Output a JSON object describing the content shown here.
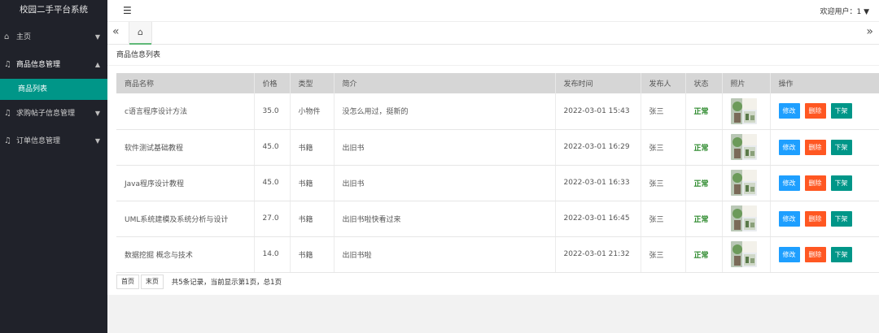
{
  "app": {
    "title": "校园二手平台系统"
  },
  "header": {
    "welcome": "欢迎用户：1",
    "welcome_caret": "▼"
  },
  "sidebar": {
    "items": [
      {
        "label": "主页",
        "icon": "home-icon"
      },
      {
        "label": "商品信息管理",
        "icon": "bell-icon",
        "open": true,
        "children": [
          {
            "label": "商品列表"
          }
        ]
      },
      {
        "label": "求购帖子信息管理",
        "icon": "bell-icon"
      },
      {
        "label": "订单信息管理",
        "icon": "bell-icon"
      }
    ]
  },
  "tabs": {
    "left_arrow": "«",
    "home": "⌂",
    "right_arrow": "»"
  },
  "card": {
    "title": "商品信息列表"
  },
  "table": {
    "headers": [
      "商品名称",
      "价格",
      "类型",
      "简介",
      "发布时间",
      "发布人",
      "状态",
      "照片",
      "操作"
    ],
    "rows": [
      {
        "name": "c语言程序设计方法",
        "price": "35.0",
        "type": "小物件",
        "desc": "没怎么用过，挺新的",
        "time": "2022-03-01 15:43",
        "user": "张三",
        "status": "正常"
      },
      {
        "name": "软件测试基础教程",
        "price": "45.0",
        "type": "书籍",
        "desc": "出旧书",
        "time": "2022-03-01 16:29",
        "user": "张三",
        "status": "正常"
      },
      {
        "name": "Java程序设计教程",
        "price": "45.0",
        "type": "书籍",
        "desc": "出旧书",
        "time": "2022-03-01 16:33",
        "user": "张三",
        "status": "正常"
      },
      {
        "name": "UML系统建模及系统分析与设计",
        "price": "27.0",
        "type": "书籍",
        "desc": "出旧书啦快看过来",
        "time": "2022-03-01 16:45",
        "user": "张三",
        "status": "正常"
      },
      {
        "name": "数据挖掘 概念与技术",
        "price": "14.0",
        "type": "书籍",
        "desc": "出旧书啦",
        "time": "2022-03-01 21:32",
        "user": "张三",
        "status": "正常"
      }
    ],
    "actions": {
      "edit": "修改",
      "delete": "删除",
      "down": "下架"
    }
  },
  "pager": {
    "first": "首页",
    "last": "末页",
    "info": "共5条记录，当前显示第1页，总1页"
  },
  "colors": {
    "accent": "#009688",
    "edit": "#1e9fff",
    "delete": "#ff5722",
    "status_ok": "#2e8b2e",
    "sidebar": "#20222a"
  }
}
